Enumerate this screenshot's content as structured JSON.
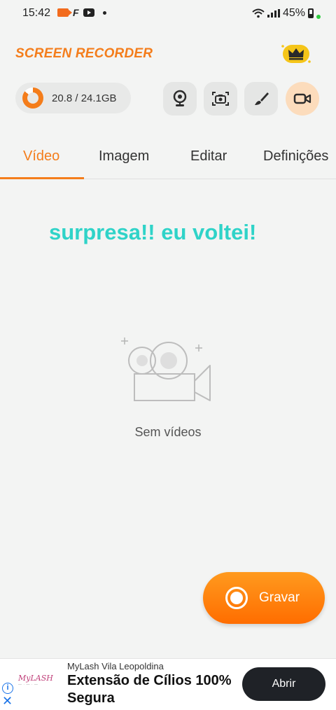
{
  "status_bar": {
    "time": "15:42",
    "battery": "45%",
    "left_icons": [
      "recorder-icon",
      "f-app-icon",
      "youtube-icon",
      "dot-icon"
    ],
    "right_icons": [
      "wifi-icon",
      "signal-icon",
      "battery-icon"
    ]
  },
  "header": {
    "title": "SCREEN RECORDER",
    "premium_icon": "crown-icon"
  },
  "storage": {
    "text": "20.8 / 24.1GB",
    "used_fraction": 0.86
  },
  "tools": [
    {
      "name": "webcam-button",
      "icon": "webcam-icon"
    },
    {
      "name": "screenshot-button",
      "icon": "camera-icon"
    },
    {
      "name": "brush-button",
      "icon": "brush-icon"
    },
    {
      "name": "video-record-button",
      "icon": "video-camera-icon",
      "active": true
    }
  ],
  "tabs": [
    {
      "label": "Vídeo",
      "active": true
    },
    {
      "label": "Imagem",
      "active": false
    },
    {
      "label": "Editar",
      "active": false
    },
    {
      "label": "Definições",
      "active": false
    }
  ],
  "main": {
    "overlay_text": "surpresa!! eu voltei!",
    "empty_label": "Sem vídeos"
  },
  "record_button": {
    "label": "Gravar"
  },
  "ad": {
    "advertiser": "MyLash Vila Leopoldina",
    "headline": "Extensão de Cílios 100% Segura",
    "cta": "Abrir",
    "logo_text": "MyLASH",
    "info_icon": "info-icon",
    "close_icon": "close-icon"
  },
  "colors": {
    "accent": "#f47d1b",
    "overlay_text": "#2fd3c8",
    "background": "#f3f4f3",
    "cta_background": "#1f2227"
  }
}
